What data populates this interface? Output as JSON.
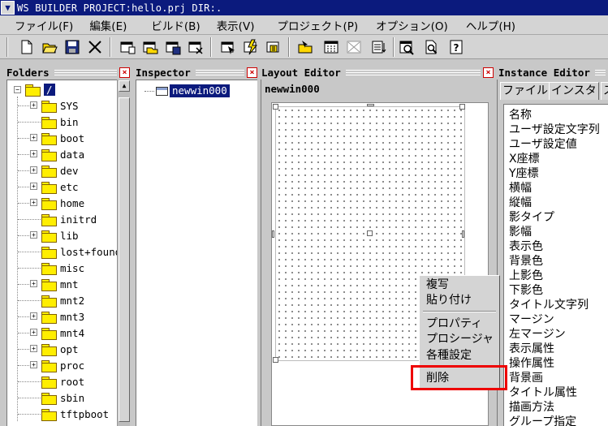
{
  "title": "WS BUILDER PROJECT:hello.prj DIR:.",
  "menu": [
    "ファイル(F)",
    "編集(E)",
    "ビルド(B)",
    "表示(V)",
    "プロジェクト(P)",
    "オプション(O)",
    "ヘルプ(H)"
  ],
  "panes": {
    "folders": "Folders",
    "inspector": "Inspector",
    "layout": "Layout Editor",
    "instance": "Instance Editor"
  },
  "folders": {
    "root": "/",
    "items": [
      "SYS",
      "bin",
      "boot",
      "data",
      "dev",
      "etc",
      "home",
      "initrd",
      "lib",
      "lost+found",
      "misc",
      "mnt",
      "mnt2",
      "mnt3",
      "mnt4",
      "opt",
      "proc",
      "root",
      "sbin",
      "tftpboot"
    ]
  },
  "inspector": {
    "node": "newwin000"
  },
  "layout": {
    "window_name": "newwin000"
  },
  "context_menu": [
    "複写",
    "貼り付け",
    "プロパティ",
    "プロシージャ",
    "各種設定",
    "削除"
  ],
  "instance": {
    "tabs": [
      "ファイル",
      "インスタ",
      "ス"
    ],
    "properties": [
      "名称",
      "ユーザ設定文字列",
      "ユーザ設定値",
      "X座標",
      "Y座標",
      "横幅",
      "縦幅",
      "影タイプ",
      "影幅",
      "表示色",
      "背景色",
      "上影色",
      "下影色",
      "タイトル文字列",
      "マージン",
      "左マージン",
      "表示属性",
      "操作属性",
      "背景画",
      "タイトル属性",
      "描画方法",
      "グループ指定"
    ]
  },
  "colors": {
    "titlebar": "#0b1a7d",
    "selection": "#0b1a7d",
    "highlight": "#e00000",
    "folder": "#ffee00"
  }
}
